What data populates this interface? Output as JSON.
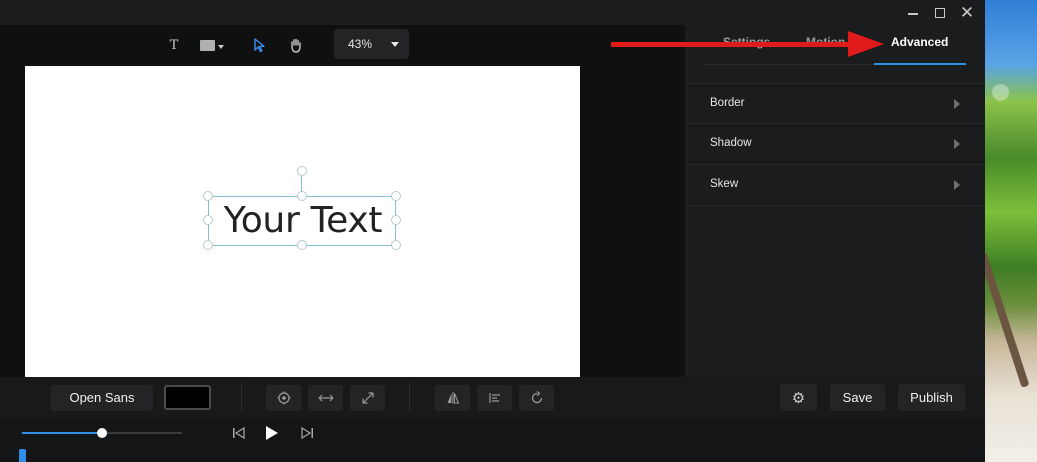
{
  "toolbar": {
    "tools": [
      "text-tool",
      "shape-tool",
      "select-tool",
      "hand-tool"
    ],
    "text_tool_glyph": "T",
    "zoom": "43%"
  },
  "canvas": {
    "text_element": "Your Text"
  },
  "panel": {
    "tabs": [
      {
        "label": "Settings"
      },
      {
        "label": "Motion"
      },
      {
        "label": "Advanced",
        "active": true
      }
    ],
    "sections": [
      {
        "label": "Border"
      },
      {
        "label": "Shadow"
      },
      {
        "label": "Skew"
      }
    ]
  },
  "bottom_toolbar": {
    "font": "Open Sans",
    "text_color": "#000000",
    "save_label": "Save",
    "publish_label": "Publish"
  },
  "timeline": {
    "progress": 0.5
  },
  "annotation": {
    "arrow_color": "#e11a1a",
    "points_to": "Advanced"
  },
  "colors": {
    "accent": "#2f8fe8",
    "selection": "#7fc1d1",
    "panel_bg": "#1b1c1d"
  }
}
